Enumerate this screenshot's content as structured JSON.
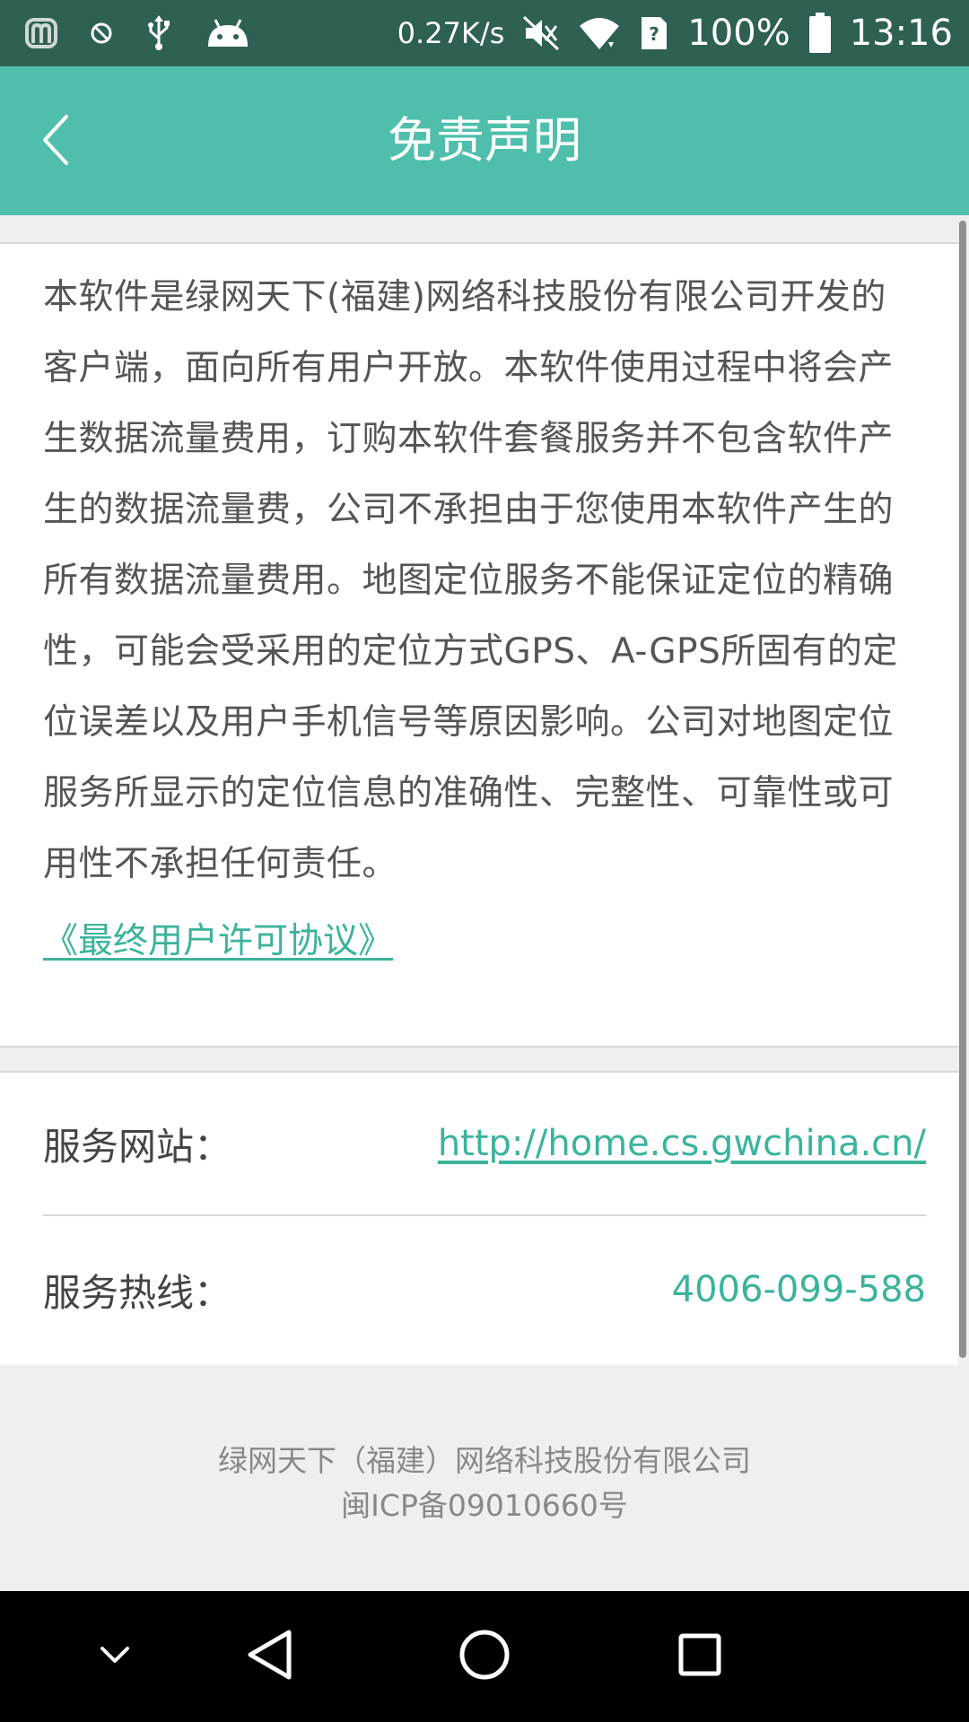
{
  "status_bar": {
    "network_speed": "0.27K/s",
    "battery_percent": "100%",
    "time": "13:16",
    "left_icons": [
      "app-m-icon",
      "blocked-icon",
      "usb-icon",
      "android-icon"
    ],
    "right_icons": [
      "mute-icon",
      "wifi-icon",
      "sim-unknown-icon",
      "battery-full-icon"
    ]
  },
  "app_bar": {
    "title": "免责声明",
    "back_icon": "chevron-left-icon"
  },
  "disclaimer": {
    "body": "本软件是绿网天下(福建)网络科技股份有限公司开发的客户端，面向所有用户开放。本软件使用过程中将会产生数据流量费用，订购本软件套餐服务并不包含软件产生的数据流量费，公司不承担由于您使用本软件产生的所有数据流量费用。地图定位服务不能保证定位的精确性，可能会受采用的定位方式GPS、A-GPS所固有的定位误差以及用户手机信号等原因影响。公司对地图定位服务所显示的定位信息的准确性、完整性、可靠性或可用性不承担任何责任。",
    "license_link": "《最终用户许可协议》"
  },
  "contact": {
    "website_label": "服务网站：",
    "website_value": "http://home.cs.gwchina.cn/",
    "hotline_label": "服务热线：",
    "hotline_value": "4006-099-588"
  },
  "footer": {
    "company": "绿网天下（福建）网络科技股份有限公司",
    "icp": "闽ICP备09010660号"
  },
  "nav_bar": {
    "icons": [
      "chevron-down-icon",
      "back-triangle-icon",
      "home-circle-icon",
      "recents-square-icon"
    ]
  },
  "colors": {
    "status_bar": "#2e6054",
    "app_bar": "#4fbfab",
    "accent": "#3bb39c",
    "text": "#555555",
    "background": "#efefef"
  }
}
